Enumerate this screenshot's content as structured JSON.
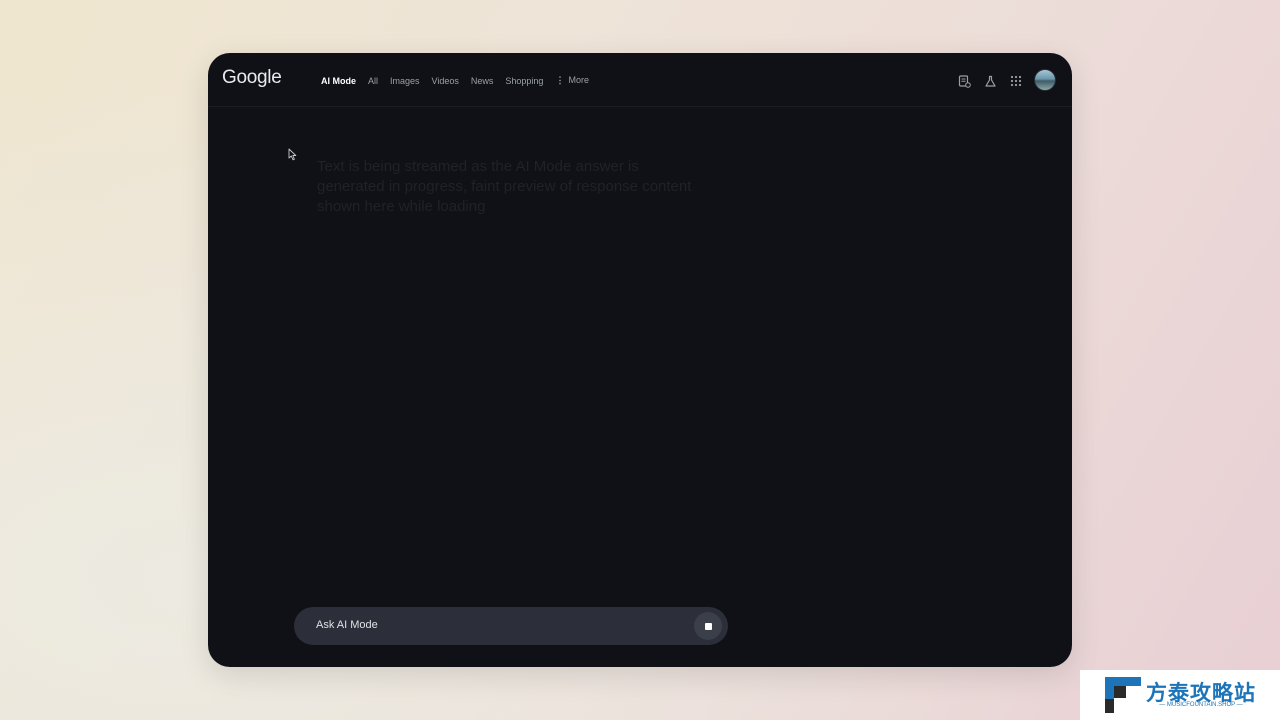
{
  "header": {
    "logo_text": "Google",
    "tabs": [
      {
        "label": "AI Mode",
        "active": true
      },
      {
        "label": "All"
      },
      {
        "label": "Images"
      },
      {
        "label": "Videos"
      },
      {
        "label": "News"
      },
      {
        "label": "Shopping"
      }
    ],
    "more_label": "More",
    "icons": [
      "search-labs-history-icon",
      "labs-flask-icon",
      "apps-grid-icon",
      "profile-avatar"
    ]
  },
  "main": {
    "response_text": "Text is being streamed as the AI Mode answer is generated in progress, faint preview of response content shown here while loading"
  },
  "ask_bar": {
    "placeholder": "Ask AI Mode",
    "stop_icon": "stop-icon"
  },
  "watermark": {
    "title": "方泰攻略站",
    "subtitle": "— MUSICFOUNTAIN.SHOP —"
  },
  "colors": {
    "window_bg": "#0f1117",
    "ask_bar_bg": "#2c2f39",
    "brand_blue": "#1d74b8"
  }
}
